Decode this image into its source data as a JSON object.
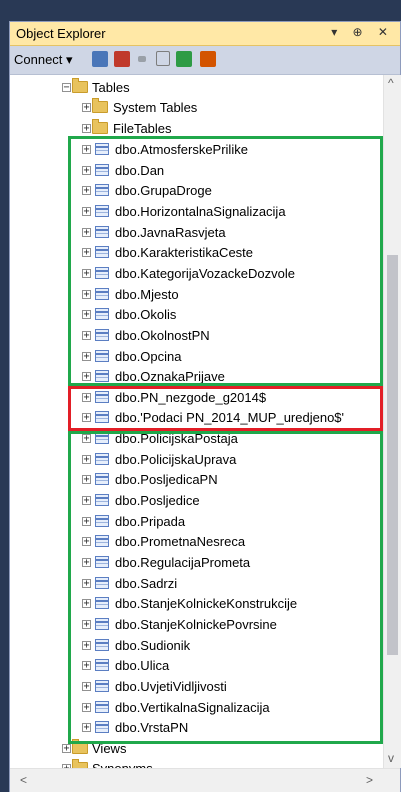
{
  "panel": {
    "title": "Object Explorer",
    "title_icons": "▾ ⊕ ✕",
    "connect_label": "Connect ▾"
  },
  "tree": {
    "tables_folder": "Tables",
    "system_tables": "System Tables",
    "file_tables": "FileTables",
    "group1": [
      "dbo.AtmosferskePrilike",
      "dbo.Dan",
      "dbo.GrupaDroge",
      "dbo.HorizontalnaSignalizacija",
      "dbo.JavnaRasvjeta",
      "dbo.KarakteristikaCeste",
      "dbo.KategorijaVozackeDozvole",
      "dbo.Mjesto",
      "dbo.Okolis",
      "dbo.OkolnostPN",
      "dbo.Opcina",
      "dbo.OznakaPrijave"
    ],
    "group2": [
      "dbo.PN_nezgode_g2014$",
      "dbo.'Podaci PN_2014_MUP_uredjeno$'"
    ],
    "group3": [
      "dbo.PolicijskaPostaja",
      "dbo.PolicijskaUprava",
      "dbo.PosljedicaPN",
      "dbo.Posljedice",
      "dbo.Pripada",
      "dbo.PrometnaNesreca",
      "dbo.RegulacijaPrometa",
      "dbo.Sadrzi",
      "dbo.StanjeKolnickeKonstrukcije",
      "dbo.StanjeKolnickePovrsine",
      "dbo.Sudionik",
      "dbo.Ulica",
      "dbo.UvjetiVidljivosti",
      "dbo.VertikalnaSignalizacija",
      "dbo.VrstaPN"
    ],
    "views_folder": "Views",
    "synonyms_folder": "Synonyms"
  },
  "scroll": {
    "up": "^",
    "down": "v",
    "left": "<",
    "right": ">"
  },
  "highlight_colors": {
    "green": "#20a84b",
    "red": "#e21e26"
  }
}
